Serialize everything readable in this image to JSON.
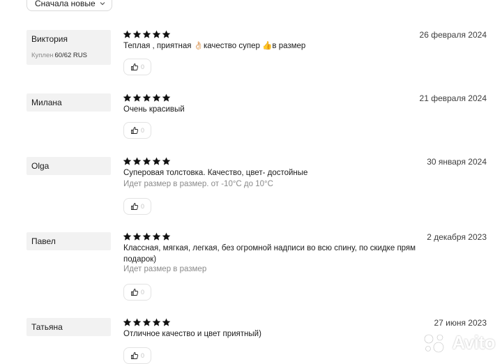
{
  "sort": {
    "label": "Сначала новые",
    "icon": "chevron-down-icon"
  },
  "icons": {
    "star": "star-icon",
    "like": "thumbs-up-icon"
  },
  "colors": {
    "star": "#111111",
    "author_bg": "#f2f2f2",
    "muted": "#8a8a8a"
  },
  "reviews": [
    {
      "author": "Виктория",
      "purchase_label": "Куплен",
      "purchase_size": "60/62 RUS",
      "rating": 5,
      "date": "26 февраля 2024",
      "text": "Теплая , приятная 👌🏻качество супер 👍в размер",
      "likes": "0"
    },
    {
      "author": "Милана",
      "rating": 5,
      "date": "21 февраля 2024",
      "text": "Очень красивый",
      "likes": "0"
    },
    {
      "author": "Olga",
      "rating": 5,
      "date": "30 января 2024",
      "text": "Суперовая толстовка. Качество, цвет- достойные",
      "note": "Идет размер в размер. от -10°С до 10°С",
      "likes": "0"
    },
    {
      "author": "Павел",
      "rating": 5,
      "date": "2 декабря 2023",
      "text": "Классная, мягкая, легкая, без огромной надписи во всю спину, по скидке прям подарок)",
      "note": "Идет размер в размер",
      "likes": "0"
    },
    {
      "author": "Татьяна",
      "rating": 5,
      "date": "27 июня 2023",
      "text": "Отличное качество и цвет приятный)",
      "likes": "0"
    }
  ],
  "watermark": {
    "text": "Avito"
  }
}
